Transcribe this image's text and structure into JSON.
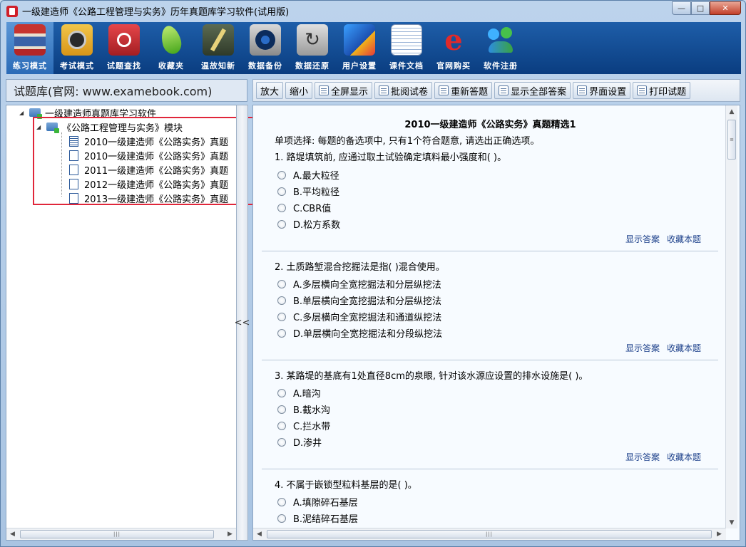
{
  "window": {
    "title": "一级建造师《公路工程管理与实务》历年真题库学习软件(试用版)",
    "min_glyph": "—",
    "max_glyph": "□",
    "close_glyph": "✕"
  },
  "toolbar": {
    "items": [
      {
        "label": "练习模式",
        "icon": "books-icon",
        "active": true
      },
      {
        "label": "考试模式",
        "icon": "clock-folder-icon"
      },
      {
        "label": "试题查找",
        "icon": "search-book-icon"
      },
      {
        "label": "收藏夹",
        "icon": "favorites-icon"
      },
      {
        "label": "温故知新",
        "icon": "review-icon"
      },
      {
        "label": "数据备份",
        "icon": "disk-backup-icon"
      },
      {
        "label": "数据还原",
        "icon": "restore-icon"
      },
      {
        "label": "用户设置",
        "icon": "monitor-settings-icon"
      },
      {
        "label": "课件文档",
        "icon": "document-icon"
      },
      {
        "label": "官网购买",
        "icon": "browser-icon"
      },
      {
        "label": "软件注册",
        "icon": "users-icon"
      }
    ]
  },
  "left_panel": {
    "header": "试题库(官网: www.examebook.com)",
    "tree": {
      "root": "一级建造师真题库学习软件",
      "module": "《公路工程管理与实务》模块",
      "papers": [
        "2010一级建造师《公路实务》真题",
        "2010一级建造师《公路实务》真题",
        "2011一级建造师《公路实务》真题",
        "2012一级建造师《公路实务》真题",
        "2013一级建造师《公路实务》真题"
      ]
    },
    "splitter_glyph": "<<"
  },
  "right_toolbar": {
    "buttons": [
      "放大",
      "缩小",
      "全屏显示",
      "批阅试卷",
      "重新答题",
      "显示全部答案",
      "界面设置",
      "打印试题"
    ]
  },
  "content": {
    "title": "2010一级建造师《公路实务》真题精选1",
    "intro": "单项选择: 每题的备选项中, 只有1个符合题意, 请选出正确选项。",
    "show_answer": "显示答案",
    "favorite": "收藏本题",
    "questions": [
      {
        "text": "1. 路堤填筑前, 应通过取土试验确定填料最小强度和( )。",
        "options": [
          "A.最大粒径",
          "B.平均粒径",
          "C.CBR值",
          "D.松方系数"
        ]
      },
      {
        "text": "2. 土质路堑混合挖掘法是指( )混合使用。",
        "options": [
          "A.多层横向全宽挖掘法和分层纵挖法",
          "B.单层横向全宽挖掘法和分层纵挖法",
          "C.多层横向全宽挖掘法和通道纵挖法",
          "D.单层横向全宽挖掘法和分段纵挖法"
        ]
      },
      {
        "text": "3. 某路堤的基底有1处直径8cm的泉眼, 针对该水源应设置的排水设施是( )。",
        "options": [
          "A.暗沟",
          "B.截水沟",
          "C.拦水带",
          "D.渗井"
        ]
      },
      {
        "text": "4. 不属于嵌锁型粒料基层的是( )。",
        "options": [
          "A.填隙碎石基层",
          "B.泥结碎石基层"
        ]
      }
    ]
  }
}
